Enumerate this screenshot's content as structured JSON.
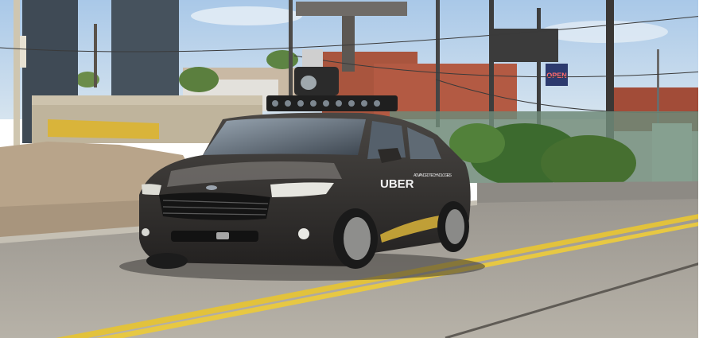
{
  "photo": {
    "description_visible_text": {
      "car_brand_badge": "UBER",
      "door_text": "ADVANCED TECHNOLOGIES",
      "shop_sign": "OPEN"
    },
    "colors": {
      "sky": "#b9d3ec",
      "road": "#a9a59c",
      "car_body": "#2e2c2b",
      "road_line": "#e2c23c",
      "pillar": "#3f4a55",
      "brick": "#a9553e",
      "dirt": "#b8a48a",
      "foliage": "#3c6a2e"
    }
  }
}
